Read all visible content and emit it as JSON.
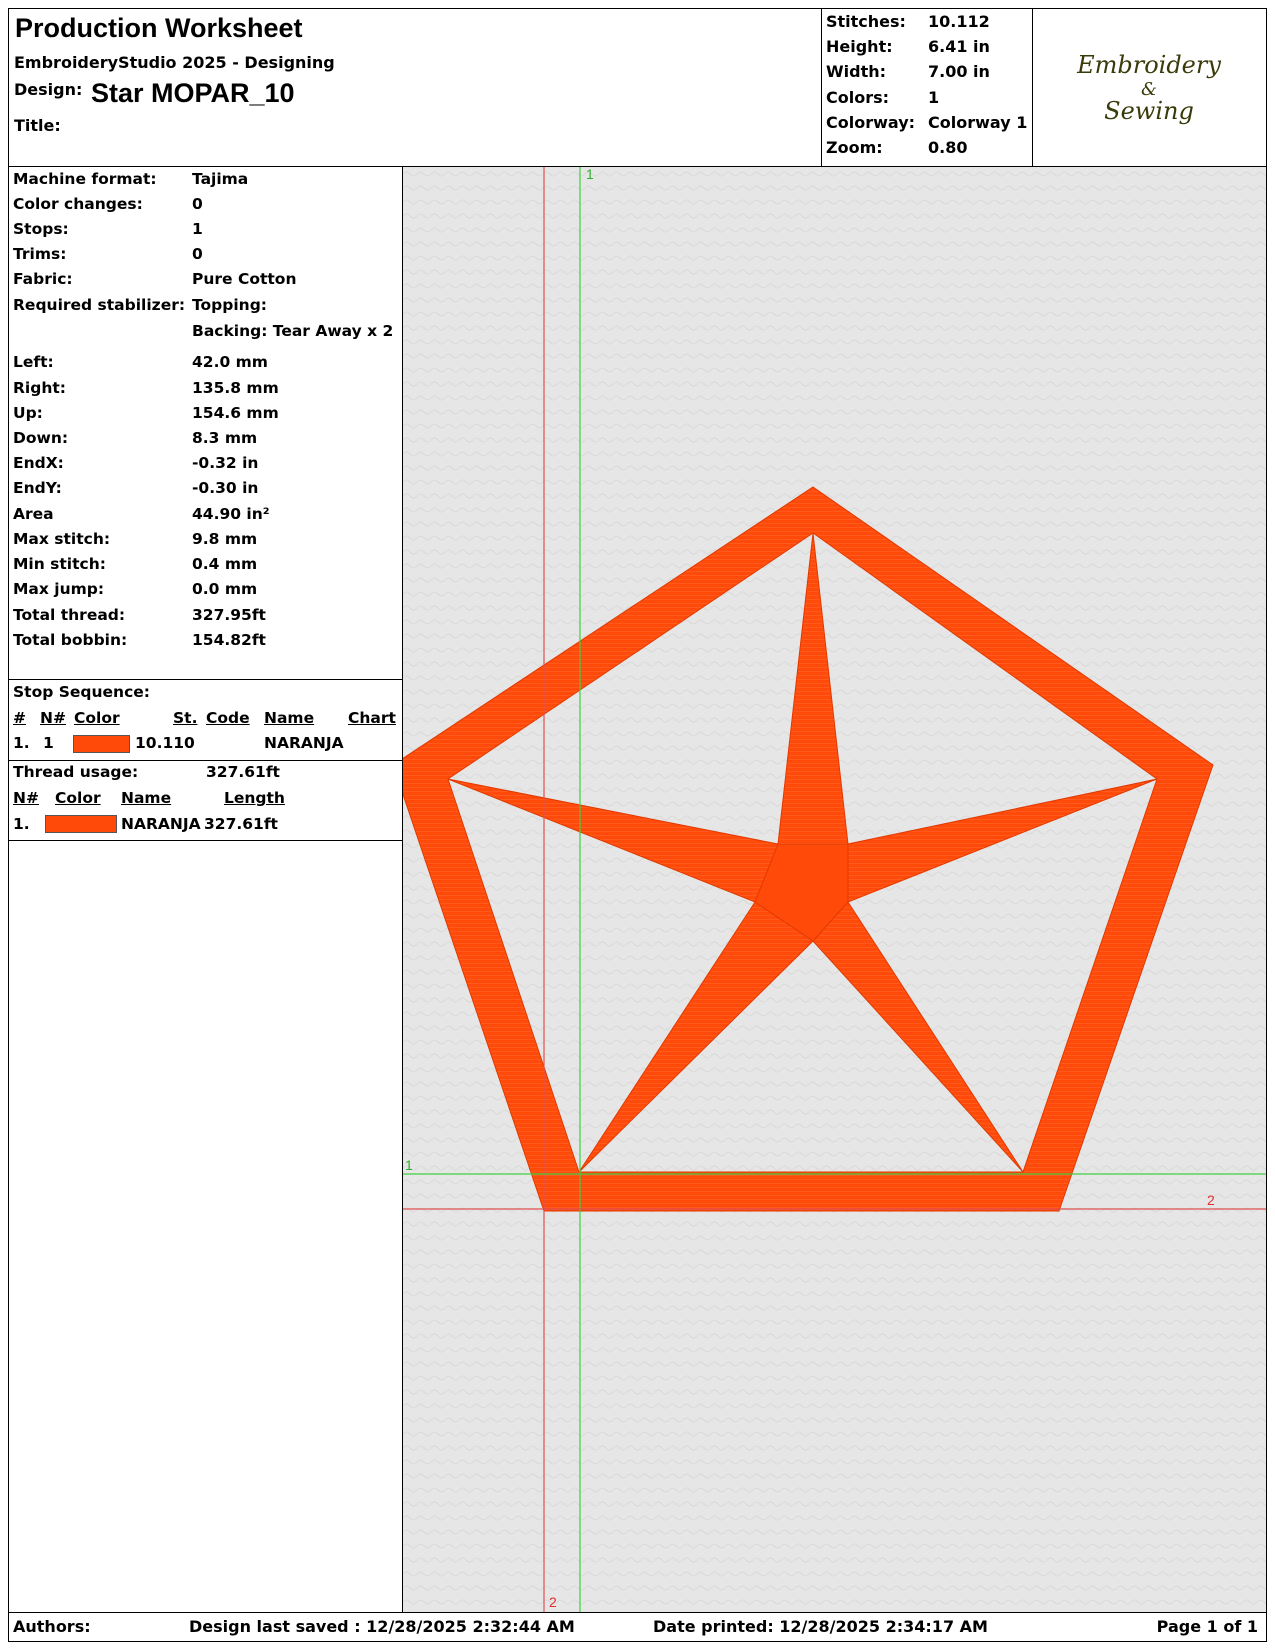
{
  "header": {
    "title": "Production Worksheet",
    "software": "EmbroideryStudio 2025 - Designing",
    "design_label": "Design:",
    "design_name": "Star MOPAR_10",
    "title_label": "Title:"
  },
  "stats": [
    {
      "label": "Stitches:",
      "value": "10.112"
    },
    {
      "label": "Height:",
      "value": "6.41 in"
    },
    {
      "label": "Width:",
      "value": "7.00 in"
    },
    {
      "label": "Colors:",
      "value": "1"
    },
    {
      "label": "Colorway:",
      "value": "Colorway 1"
    },
    {
      "label": "Zoom:",
      "value": "0.80"
    }
  ],
  "logo": {
    "line1": "Embroidery",
    "line2": "&",
    "line3": "Sewing"
  },
  "props": [
    {
      "label": "Machine format:",
      "value": "Tajima"
    },
    {
      "label": "Color changes:",
      "value": "0"
    },
    {
      "label": "Stops:",
      "value": "1"
    },
    {
      "label": "Trims:",
      "value": "0"
    },
    {
      "label": "Fabric:",
      "value": "Pure Cotton"
    },
    {
      "label": "Required stabilizer:",
      "value": "Topping:"
    },
    {
      "label": "",
      "value": "Backing: Tear Away x 2"
    },
    {
      "label": "Left:",
      "value": "42.0 mm"
    },
    {
      "label": "Right:",
      "value": "135.8 mm"
    },
    {
      "label": "Up:",
      "value": "154.6 mm"
    },
    {
      "label": "Down:",
      "value": "8.3 mm"
    },
    {
      "label": "EndX:",
      "value": "-0.32 in"
    },
    {
      "label": "EndY:",
      "value": "-0.30 in"
    },
    {
      "label": "Area",
      "value": " 44.90 in²"
    },
    {
      "label": "Max stitch:",
      "value": "9.8 mm"
    },
    {
      "label": "Min stitch:",
      "value": "0.4 mm"
    },
    {
      "label": "Max jump:",
      "value": "0.0 mm"
    },
    {
      "label": "Total thread:",
      "value": "327.95ft"
    },
    {
      "label": "Total bobbin:",
      "value": "154.82ft"
    }
  ],
  "stop_sequence": {
    "title": "Stop Sequence:",
    "headers": [
      "#",
      "N#",
      "Color",
      "St.",
      "Code",
      "Name",
      "Chart"
    ],
    "rows": [
      {
        "num": "1.",
        "n": "1",
        "stitches": "10.110",
        "name": "NARANJA",
        "color": "#FF4A0A"
      }
    ]
  },
  "thread_usage": {
    "label": "Thread usage:",
    "value": "327.61ft",
    "headers": [
      "N#",
      "Color",
      "Name",
      "Length"
    ],
    "rows": [
      {
        "num": "1.",
        "name": "NARANJA",
        "length": "327.61ft",
        "color": "#FF4A0A"
      }
    ]
  },
  "canvas": {
    "guide_labels": {
      "green_v": "1",
      "green_h": "1",
      "red_h": "2",
      "red_v": "2"
    },
    "thread_color": "#FF4A0A",
    "background": "#e6e6e6"
  },
  "footer": {
    "authors": "Authors:",
    "saved": "Design last saved : 12/28/2025 2:32:44 AM",
    "printed": "Date printed: 12/28/2025 2:34:17 AM",
    "page": "Page 1 of 1"
  }
}
